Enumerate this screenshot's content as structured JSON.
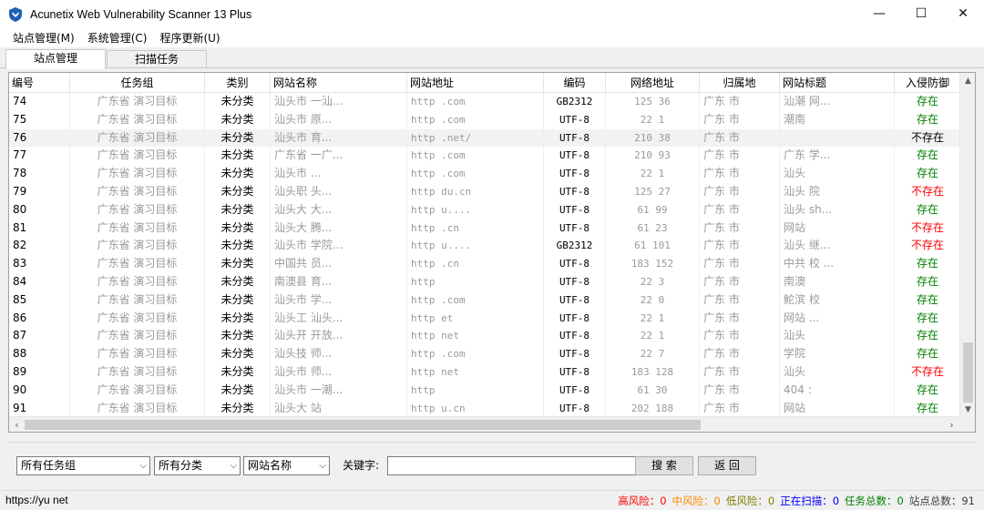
{
  "window": {
    "title": "Acunetix Web Vulnerability Scanner 13 Plus",
    "controls": {
      "minimize": "—",
      "maximize": "☐",
      "close": "✕"
    }
  },
  "menu": [
    "站点管理(M)",
    "系统管理(C)",
    "程序更新(U)"
  ],
  "tabs": [
    "站点管理",
    "扫描任务"
  ],
  "table": {
    "headers": [
      "编号",
      "任务组",
      "类别",
      "网站名称",
      "网站地址",
      "编码",
      "网络地址",
      "归属地",
      "网站标题",
      "入侵防御"
    ],
    "rows": [
      {
        "id": "74",
        "group": "广东省   演习目标",
        "cat": "未分类",
        "name": "汕头市        一汕...",
        "url": "http           .com",
        "enc": "GB2312",
        "ip": "125         36",
        "loc": "广东       市",
        "title": "汕潮      网...",
        "status": "存在",
        "flag": "ok"
      },
      {
        "id": "75",
        "group": "广东省   演习目标",
        "cat": "未分类",
        "name": "汕头市        原...",
        "url": "http           .com",
        "enc": "UTF-8",
        "ip": "22          1",
        "loc": "广东       市",
        "title": "潮南",
        "status": "存在",
        "flag": "ok"
      },
      {
        "id": "76",
        "group": "广东省   演习目标",
        "cat": "未分类",
        "name": "汕头市        育...",
        "url": "http          .net/",
        "enc": "UTF-8",
        "ip": "210         38",
        "loc": "广东       市",
        "title": "",
        "status": "不存在",
        "flag": "plain"
      },
      {
        "id": "77",
        "group": "广东省   演习目标",
        "cat": "未分类",
        "name": "广东省        一广...",
        "url": "http           .com",
        "enc": "UTF-8",
        "ip": "210         93",
        "loc": "广东       市",
        "title": "广东      学...",
        "status": "存在",
        "flag": "ok"
      },
      {
        "id": "78",
        "group": "广东省   演习目标",
        "cat": "未分类",
        "name": "汕头市        ...",
        "url": "http           .com",
        "enc": "UTF-8",
        "ip": "22          1",
        "loc": "广东       市",
        "title": "汕头",
        "status": "存在",
        "flag": "ok"
      },
      {
        "id": "79",
        "group": "广东省   演习目标",
        "cat": "未分类",
        "name": "汕头职        头...",
        "url": "http         du.cn",
        "enc": "UTF-8",
        "ip": "125         27",
        "loc": "广东       市",
        "title": "汕头      院",
        "status": "不存在",
        "flag": "bad"
      },
      {
        "id": "80",
        "group": "广东省   演习目标",
        "cat": "未分类",
        "name": "汕头大        大...",
        "url": "http          u....",
        "enc": "UTF-8",
        "ip": "61          99",
        "loc": "广东       市",
        "title": "汕头       sh...",
        "status": "存在",
        "flag": "ok"
      },
      {
        "id": "81",
        "group": "广东省   演习目标",
        "cat": "未分类",
        "name": "汕头大        腾...",
        "url": "http          .cn",
        "enc": "UTF-8",
        "ip": "61          23",
        "loc": "广东       市",
        "title": "网站",
        "status": "不存在",
        "flag": "bad"
      },
      {
        "id": "82",
        "group": "广东省   演习目标",
        "cat": "未分类",
        "name": "汕头市        学院...",
        "url": "http          u....",
        "enc": "GB2312",
        "ip": "61         101",
        "loc": "广东       市",
        "title": "汕头      继...",
        "status": "不存在",
        "flag": "bad"
      },
      {
        "id": "83",
        "group": "广东省   演习目标",
        "cat": "未分类",
        "name": "中国共        员...",
        "url": "http           .cn",
        "enc": "UTF-8",
        "ip": "183        152",
        "loc": "广东       市",
        "title": "中共      校 ...",
        "status": "存在",
        "flag": "ok"
      },
      {
        "id": "84",
        "group": "广东省   演习目标",
        "cat": "未分类",
        "name": "南澳县        育...",
        "url": "http",
        "enc": "UTF-8",
        "ip": "22          3",
        "loc": "广东       市",
        "title": "南澳",
        "status": "存在",
        "flag": "ok"
      },
      {
        "id": "85",
        "group": "广东省   演习目标",
        "cat": "未分类",
        "name": "汕头市        学...",
        "url": "http           .com",
        "enc": "UTF-8",
        "ip": "22          0",
        "loc": "广东       市",
        "title": "鮀滨      校",
        "status": "存在",
        "flag": "ok"
      },
      {
        "id": "86",
        "group": "广东省   演习目标",
        "cat": "未分类",
        "name": "汕头工        汕头...",
        "url": "http           et",
        "enc": "UTF-8",
        "ip": "22          1",
        "loc": "广东       市",
        "title": "网站      ...",
        "status": "存在",
        "flag": "ok"
      },
      {
        "id": "87",
        "group": "广东省   演习目标",
        "cat": "未分类",
        "name": "汕头开        开放...",
        "url": "http           net",
        "enc": "UTF-8",
        "ip": "22          1",
        "loc": "广东       市",
        "title": "汕头",
        "status": "存在",
        "flag": "ok"
      },
      {
        "id": "88",
        "group": "广东省   演习目标",
        "cat": "未分类",
        "name": "汕头技        师...",
        "url": "http           .com",
        "enc": "UTF-8",
        "ip": "22          7",
        "loc": "广东       市",
        "title": "学院",
        "status": "存在",
        "flag": "ok"
      },
      {
        "id": "89",
        "group": "广东省   演习目标",
        "cat": "未分类",
        "name": "汕头市        师...",
        "url": "http           net",
        "enc": "UTF-8",
        "ip": "183        128",
        "loc": "广东       市",
        "title": "汕头",
        "status": "不存在",
        "flag": "bad"
      },
      {
        "id": "90",
        "group": "广东省   演习目标",
        "cat": "未分类",
        "name": "汕头市        一潮...",
        "url": "http",
        "enc": "UTF-8",
        "ip": "61          30",
        "loc": "广东       市",
        "title": "404 :",
        "status": "存在",
        "flag": "ok"
      },
      {
        "id": "91",
        "group": "广东省   演习目标",
        "cat": "未分类",
        "name": "汕头大        站",
        "url": "http          u.cn",
        "enc": "UTF-8",
        "ip": "202        188",
        "loc": "广东       市",
        "title": "网站",
        "status": "存在",
        "flag": "ok"
      }
    ]
  },
  "filters": {
    "group_select": "所有任务组",
    "category_select": "所有分类",
    "field_select": "网站名称",
    "keyword_label": "关键字:",
    "keyword_value": "",
    "search_button": "搜 索",
    "back_button": "返 回"
  },
  "status": {
    "url": "https://yu         net",
    "stats": [
      {
        "text": "高风险：0",
        "color": "#ff0000"
      },
      {
        "text": "中风险：0",
        "color": "#ff8c00"
      },
      {
        "text": "低风险：0",
        "color": "#808000"
      },
      {
        "text": "正在扫描：0",
        "color": "#0000ff"
      },
      {
        "text": "任务总数：0",
        "color": "#008000"
      },
      {
        "text": "站点总数：91",
        "color": "#404040"
      }
    ]
  },
  "colors": {
    "ok": "#008000",
    "bad": "#ff0000",
    "brand_icon": "#1e5fb4"
  }
}
